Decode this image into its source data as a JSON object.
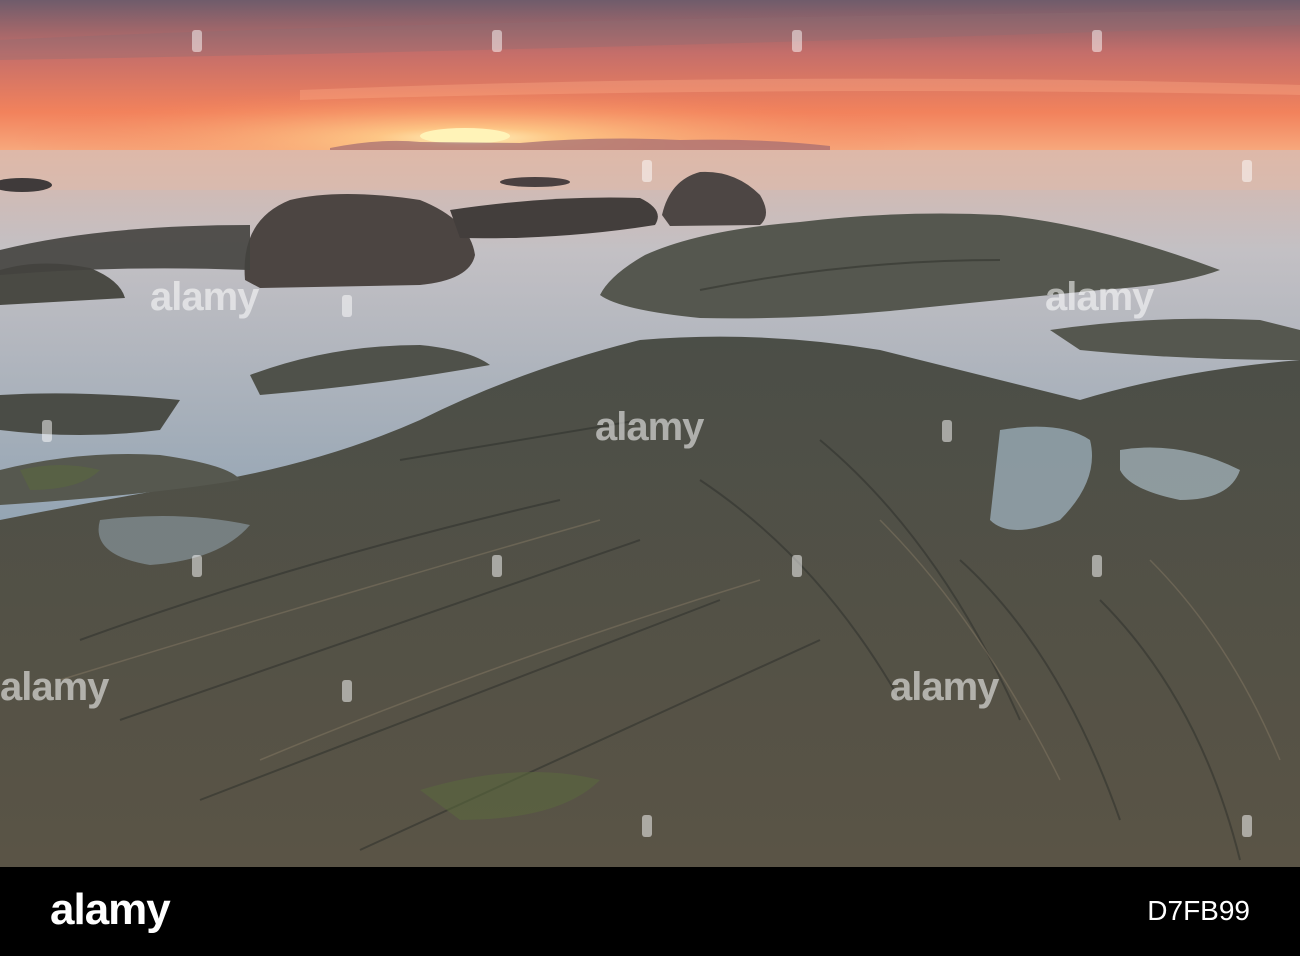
{
  "image": {
    "subject": "rocky-shore-sunset",
    "colors": {
      "sky_top": "#7a5f6a",
      "sky_glow": "#f27a56",
      "sun": "#fff2b0",
      "sea": "#b7c3cc",
      "rock": "#4d5047",
      "footer_bg": "#000000"
    }
  },
  "watermark": {
    "text": "alamy"
  },
  "footer": {
    "logo": "alamy",
    "image_id": "D7FB99"
  }
}
